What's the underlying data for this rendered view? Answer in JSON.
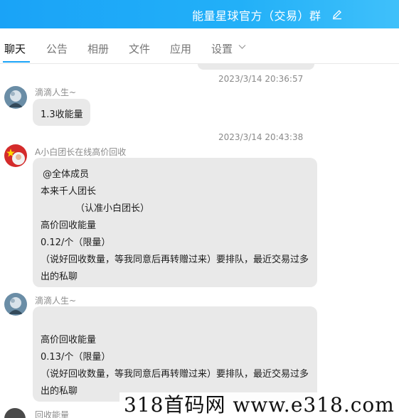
{
  "header": {
    "title": "能量星球官方（交易）群",
    "edit_icon": "pencil-icon"
  },
  "tabs": [
    {
      "label": "聊天",
      "active": true
    },
    {
      "label": "公告"
    },
    {
      "label": "相册"
    },
    {
      "label": "文件"
    },
    {
      "label": "应用"
    },
    {
      "label": "设置"
    }
  ],
  "messages": [
    {
      "timestamp": "2023/3/14 20:36:57",
      "sender": "滴滴人生~",
      "lines": [
        "1.3收能量"
      ]
    },
    {
      "timestamp": "2023/3/14 20:43:38",
      "sender": "A小白团长在线高价回收",
      "lines": [
        "@全体成员",
        "本来千人团长",
        "（认准小白团长）",
        "高价回收能量",
        "0.12/个（限量）",
        "（说好回收数量，等我同意后再转赠过来）要排队，最近交易过多",
        "出的私聊"
      ]
    },
    {
      "sender": "滴滴人生~",
      "lines": [
        "",
        "高价回收能量",
        "0.13/个（限量）",
        "（说好回收数量，等我同意后再转赠过来）要排队，最近交易过多",
        "出的私聊"
      ]
    },
    {
      "sender": "回收能量"
    }
  ],
  "watermark": "318首码网 www.e318.com",
  "colors": {
    "header": "#1aa3f7",
    "bubble": "#e9e9e9",
    "active_tab_underline": "#1aa3f7"
  }
}
